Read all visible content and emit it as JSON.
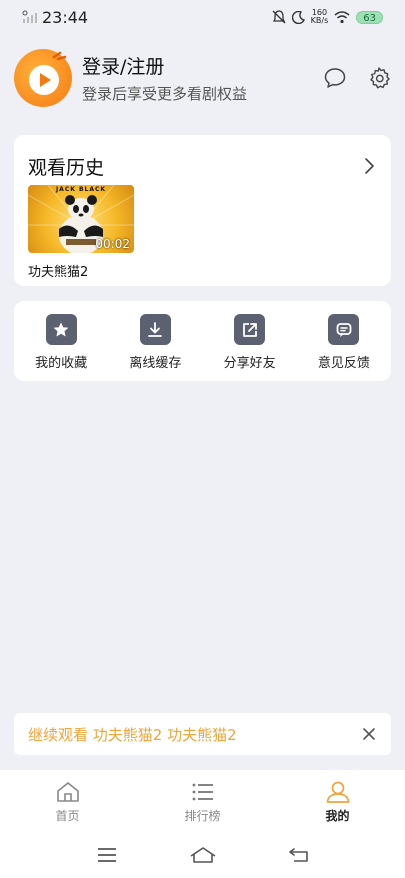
{
  "status_bar": {
    "time": "23:44",
    "net_speed_value": "160",
    "net_speed_unit": "KB/s",
    "battery": "63"
  },
  "profile": {
    "title": "登录/注册",
    "subtitle": "登录后享受更多看剧权益",
    "message_icon": "chat-bubble-icon",
    "settings_icon": "gear-icon"
  },
  "history": {
    "title": "观看历史",
    "items": [
      {
        "title": "功夫熊猫2",
        "time": "00:02",
        "thumb_brand": "JACK BLACK"
      }
    ]
  },
  "tools": [
    {
      "label": "我的收藏",
      "icon": "star-icon"
    },
    {
      "label": "离线缓存",
      "icon": "download-icon"
    },
    {
      "label": "分享好友",
      "icon": "share-icon"
    },
    {
      "label": "意见反馈",
      "icon": "feedback-icon"
    }
  ],
  "resume": {
    "text": "继续观看 功夫熊猫2 功夫熊猫2"
  },
  "tabs": [
    {
      "label": "首页",
      "icon": "home-icon",
      "active": false
    },
    {
      "label": "排行榜",
      "icon": "list-icon",
      "active": false
    },
    {
      "label": "我的",
      "icon": "person-icon",
      "active": true
    }
  ],
  "colors": {
    "accent": "#f0a43a",
    "tool_icon_bg": "#5b6170",
    "page_bg": "#eef0f5"
  }
}
